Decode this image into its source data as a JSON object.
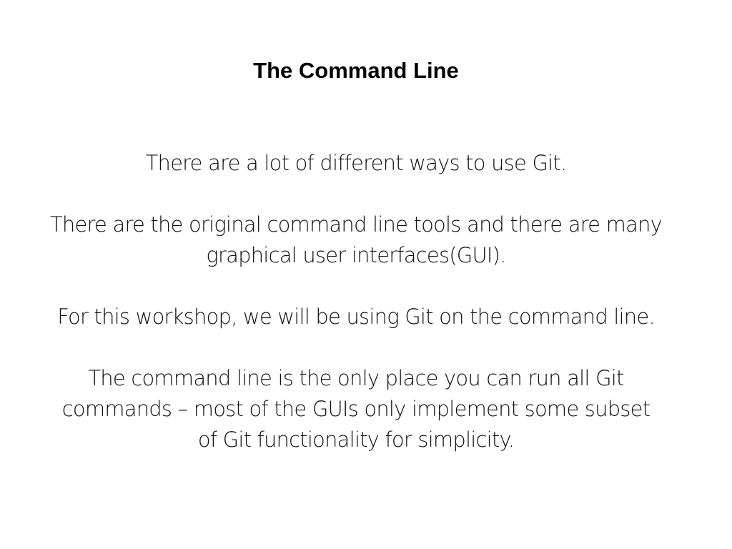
{
  "slide": {
    "title": "The Command Line",
    "paragraphs": [
      [
        "There are a lot of different ways to use Git."
      ],
      [
        "There are the original command line tools and there are many",
        "graphical user interfaces(GUI)."
      ],
      [
        "For this workshop, we will be using Git on the command line."
      ],
      [
        "The command line is the only place you can run all Git",
        "commands – most of the GUIs only implement some subset",
        "of Git functionality for simplicity."
      ]
    ]
  }
}
